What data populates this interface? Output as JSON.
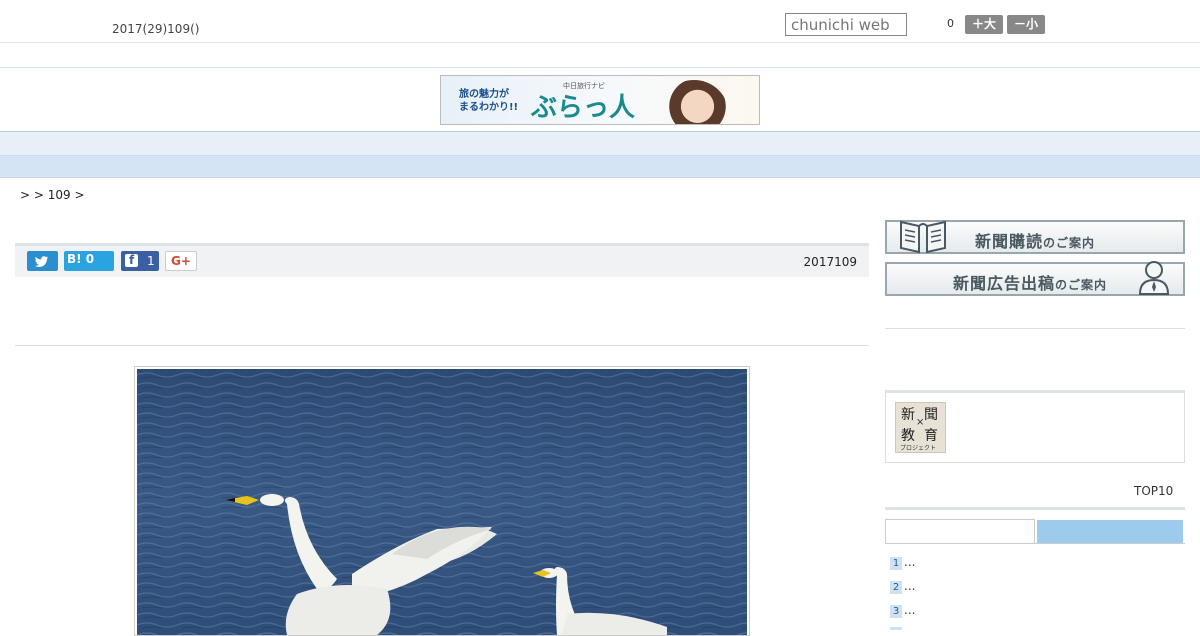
{
  "header": {
    "date_text": "2017(29)109()",
    "search_placeholder": "chunichi web",
    "count": "0",
    "font_larger_label": "＋大",
    "font_smaller_label": "－小"
  },
  "banner": {
    "line1": "旅の魅力が",
    "line2": "まるわかり!!",
    "sub": "中日旅行ナビ",
    "brand": "ぶらっ人"
  },
  "nav": {
    "items": [
      "",
      "",
      "",
      "",
      "",
      "",
      "",
      "",
      ""
    ]
  },
  "breadcrumb": ">  > 109 >",
  "share": {
    "hatena_label": "B! 0",
    "facebook_count": "1",
    "gplus_label": "G+",
    "article_date": "2017109"
  },
  "sidebar": {
    "subscribe_main": "新聞購読",
    "subscribe_small": "のご案内",
    "ad_main": "新聞広告出稿",
    "ad_small": "のご案内",
    "edu_logo": {
      "k1": "新",
      "k2": "聞",
      "k3": "教",
      "k4": "育",
      "x": "×",
      "sub": "プロジェクト"
    },
    "top10_label": "TOP10",
    "rankings": [
      {
        "num": "1",
        "text": "..."
      },
      {
        "num": "2",
        "text": "..."
      },
      {
        "num": "3",
        "text": "..."
      }
    ]
  },
  "colors": {
    "nav_bg": "#e7eff9",
    "subnav_bg": "#d4e4f5",
    "twitter": "#2b8fcf",
    "hatena": "#2aa3e0",
    "facebook": "#3b5fa3",
    "tab_active": "#9ccbee"
  }
}
